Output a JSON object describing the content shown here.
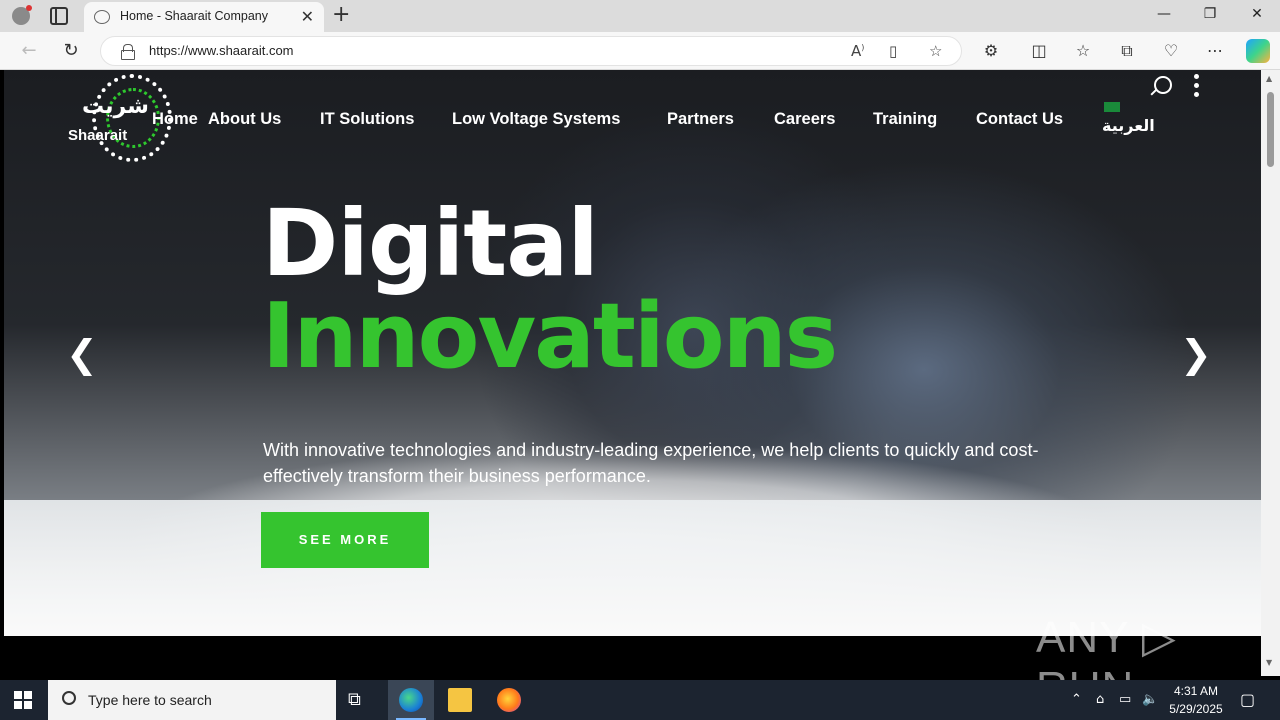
{
  "browser": {
    "tab_title": "Home - Shaarait Company",
    "tab_close": "✕",
    "new_tab": "+",
    "url": "https://www.shaarait.com",
    "window_controls": [
      "—",
      "❐",
      "✕"
    ]
  },
  "site": {
    "logo_ar": "شريت",
    "logo_en": "Shaarait",
    "nav": [
      "Home",
      "About Us",
      "IT Solutions",
      "Low Voltage Systems",
      "Partners",
      "Careers",
      "Training",
      "Contact Us"
    ],
    "language": "العربية",
    "hero": {
      "title_line1": "Digital",
      "title_line2": "Innovations",
      "description": "With innovative technologies and industry-leading experience, we help clients to quickly and cost-effectively transform their business performance.",
      "cta": "SEE MORE",
      "prev_arrow": "❮",
      "next_arrow": "❯"
    },
    "colors": {
      "accent": "#35c42f",
      "text": "#ffffff"
    }
  },
  "watermark": "ANY ▷ RUN",
  "taskbar": {
    "search_placeholder": "Type here to search",
    "time": "4:31 AM",
    "date": "5/29/2025"
  }
}
